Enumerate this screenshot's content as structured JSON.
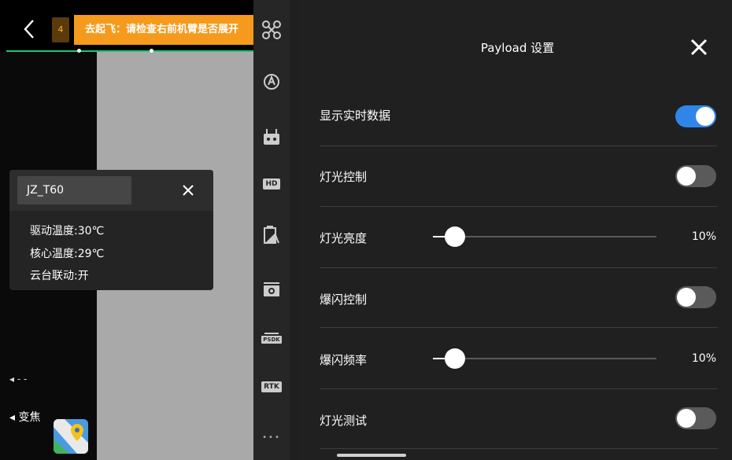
{
  "camera": {
    "badge": "4",
    "warning": "去起飞：请检查右前机臂是否展开",
    "device_name": "JZ_T60",
    "info_lines": [
      "驱动温度:30℃",
      "核心温度:29℃",
      "云台联动:开"
    ],
    "zoom_label": "◂ 变焦",
    "dash_label": "◂ - -"
  },
  "toolbar": {
    "items": [
      {
        "name": "drone-icon",
        "text": ""
      },
      {
        "name": "auto-icon",
        "text": ""
      },
      {
        "name": "remote-controller-icon",
        "text": ""
      },
      {
        "name": "hd-icon",
        "text": "HD"
      },
      {
        "name": "battery-icon",
        "text": ""
      },
      {
        "name": "gimbal-camera-icon",
        "text": ""
      },
      {
        "name": "psdk-icon",
        "text": "PSDK"
      },
      {
        "name": "rtk-icon",
        "text": "RTK"
      },
      {
        "name": "more-icon",
        "text": "•••"
      }
    ]
  },
  "panel": {
    "title": "Payload 设置",
    "rows": {
      "live_data": {
        "label": "显示实时数据",
        "on": true
      },
      "light_control": {
        "label": "灯光控制",
        "on": false
      },
      "brightness": {
        "label": "灯光亮度",
        "value": 10,
        "value_text": "10%"
      },
      "strobe_control": {
        "label": "爆闪控制",
        "on": false
      },
      "strobe_freq": {
        "label": "爆闪频率",
        "value": 10,
        "value_text": "10%"
      },
      "light_test": {
        "label": "灯光测试",
        "on": false
      }
    }
  },
  "colors": {
    "accent": "#2f86e8",
    "warning": "#f59a1c",
    "progress": "#22c36b"
  }
}
